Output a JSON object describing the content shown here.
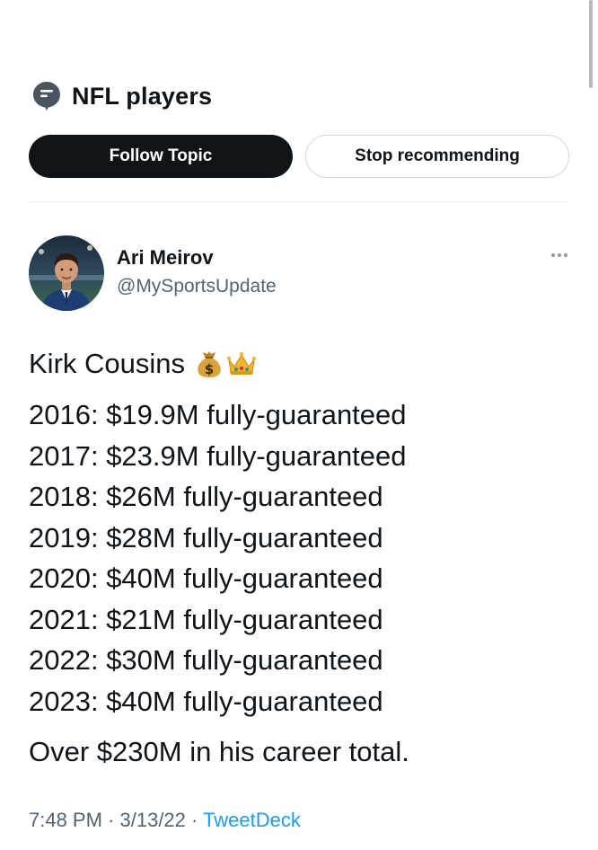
{
  "topic": {
    "title": "NFL players",
    "icon": "topic-bubble-icon",
    "follow_label": "Follow Topic",
    "stop_label": "Stop recommending"
  },
  "tweet": {
    "author_name": "Ari Meirov",
    "author_handle": "@MySportsUpdate",
    "avatar": "avatar-photo",
    "more_icon": "more-dots-icon",
    "headline": "Kirk Cousins",
    "headline_emojis": [
      "money-bag-emoji",
      "crown-emoji"
    ],
    "lines": [
      "2016: $19.9M fully-guaranteed",
      "2017: $23.9M fully-guaranteed",
      "2018: $26M fully-guaranteed",
      "2019: $28M fully-guaranteed",
      "2020: $40M fully-guaranteed",
      "2021: $21M fully-guaranteed",
      "2022: $30M fully-guaranteed",
      "2023: $40M fully-guaranteed"
    ],
    "summary": "Over $230M in his career total.",
    "time": "7:48 PM",
    "separator": " · ",
    "date": "3/13/22",
    "source": "TweetDeck"
  },
  "colors": {
    "text_primary": "#0f1419",
    "text_secondary": "#536471",
    "link": "#1d9bf0",
    "border": "#cfd9de",
    "topic_icon": "#4a5561"
  }
}
